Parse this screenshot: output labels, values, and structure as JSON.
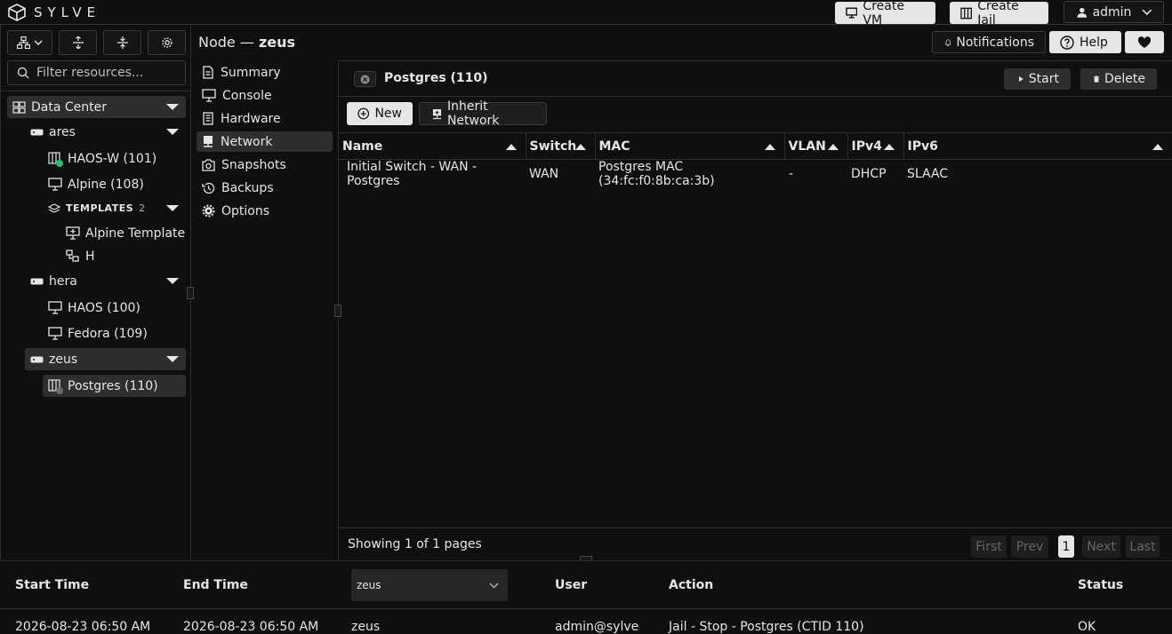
{
  "brand": {
    "name": "SYLVE"
  },
  "topbar": {
    "create_vm": "Create VM",
    "create_jail": "Create Jail",
    "user": "admin"
  },
  "header": {
    "prefix": "Node —",
    "node": "zeus",
    "notifications": "Notifications",
    "help": "Help"
  },
  "sidebar": {
    "filter_placeholder": "Filter resources...",
    "tree": {
      "datacenter": "Data Center",
      "ares": "ares",
      "haosw": "HAOS-W (101)",
      "alpine": "Alpine (108)",
      "templates": "TEMPLATES",
      "templates_count": "2",
      "alpine_template": "Alpine Template",
      "h": "H",
      "hera": "hera",
      "haos": "HAOS (100)",
      "fedora": "Fedora (109)",
      "zeus": "zeus",
      "postgres": "Postgres (110)"
    }
  },
  "menu": {
    "items": [
      "Summary",
      "Console",
      "Hardware",
      "Network",
      "Snapshots",
      "Backups",
      "Options"
    ],
    "selected": "Network"
  },
  "panel": {
    "title": "Postgres (110)",
    "start": "Start",
    "delete": "Delete",
    "new": "New",
    "inherit": "Inherit Network",
    "columns": [
      "Name",
      "Switch",
      "MAC",
      "VLAN",
      "IPv4",
      "IPv6"
    ],
    "rows": [
      [
        "Initial Switch - WAN - Postgres",
        "WAN",
        "Postgres MAC (34:fc:f0:8b:ca:3b)",
        "-",
        "DHCP",
        "SLAAC"
      ]
    ],
    "pager": {
      "status": "Showing 1 of 1 pages",
      "first": "First",
      "prev": "Prev",
      "page": "1",
      "next": "Next",
      "last": "Last"
    }
  },
  "log": {
    "headers": {
      "start": "Start Time",
      "end": "End Time",
      "node_filter": "zeus",
      "user": "User",
      "action": "Action",
      "status": "Status"
    },
    "row": {
      "start": "2026-08-23 06:50 AM",
      "end": "2026-08-23 06:50 AM",
      "node": "zeus",
      "user": "admin@sylve",
      "action": "Jail - Stop - Postgres (CTID 110)",
      "status": "OK"
    }
  },
  "colors": {
    "running": "#22c55e",
    "stopped": "#6b6b6b"
  }
}
